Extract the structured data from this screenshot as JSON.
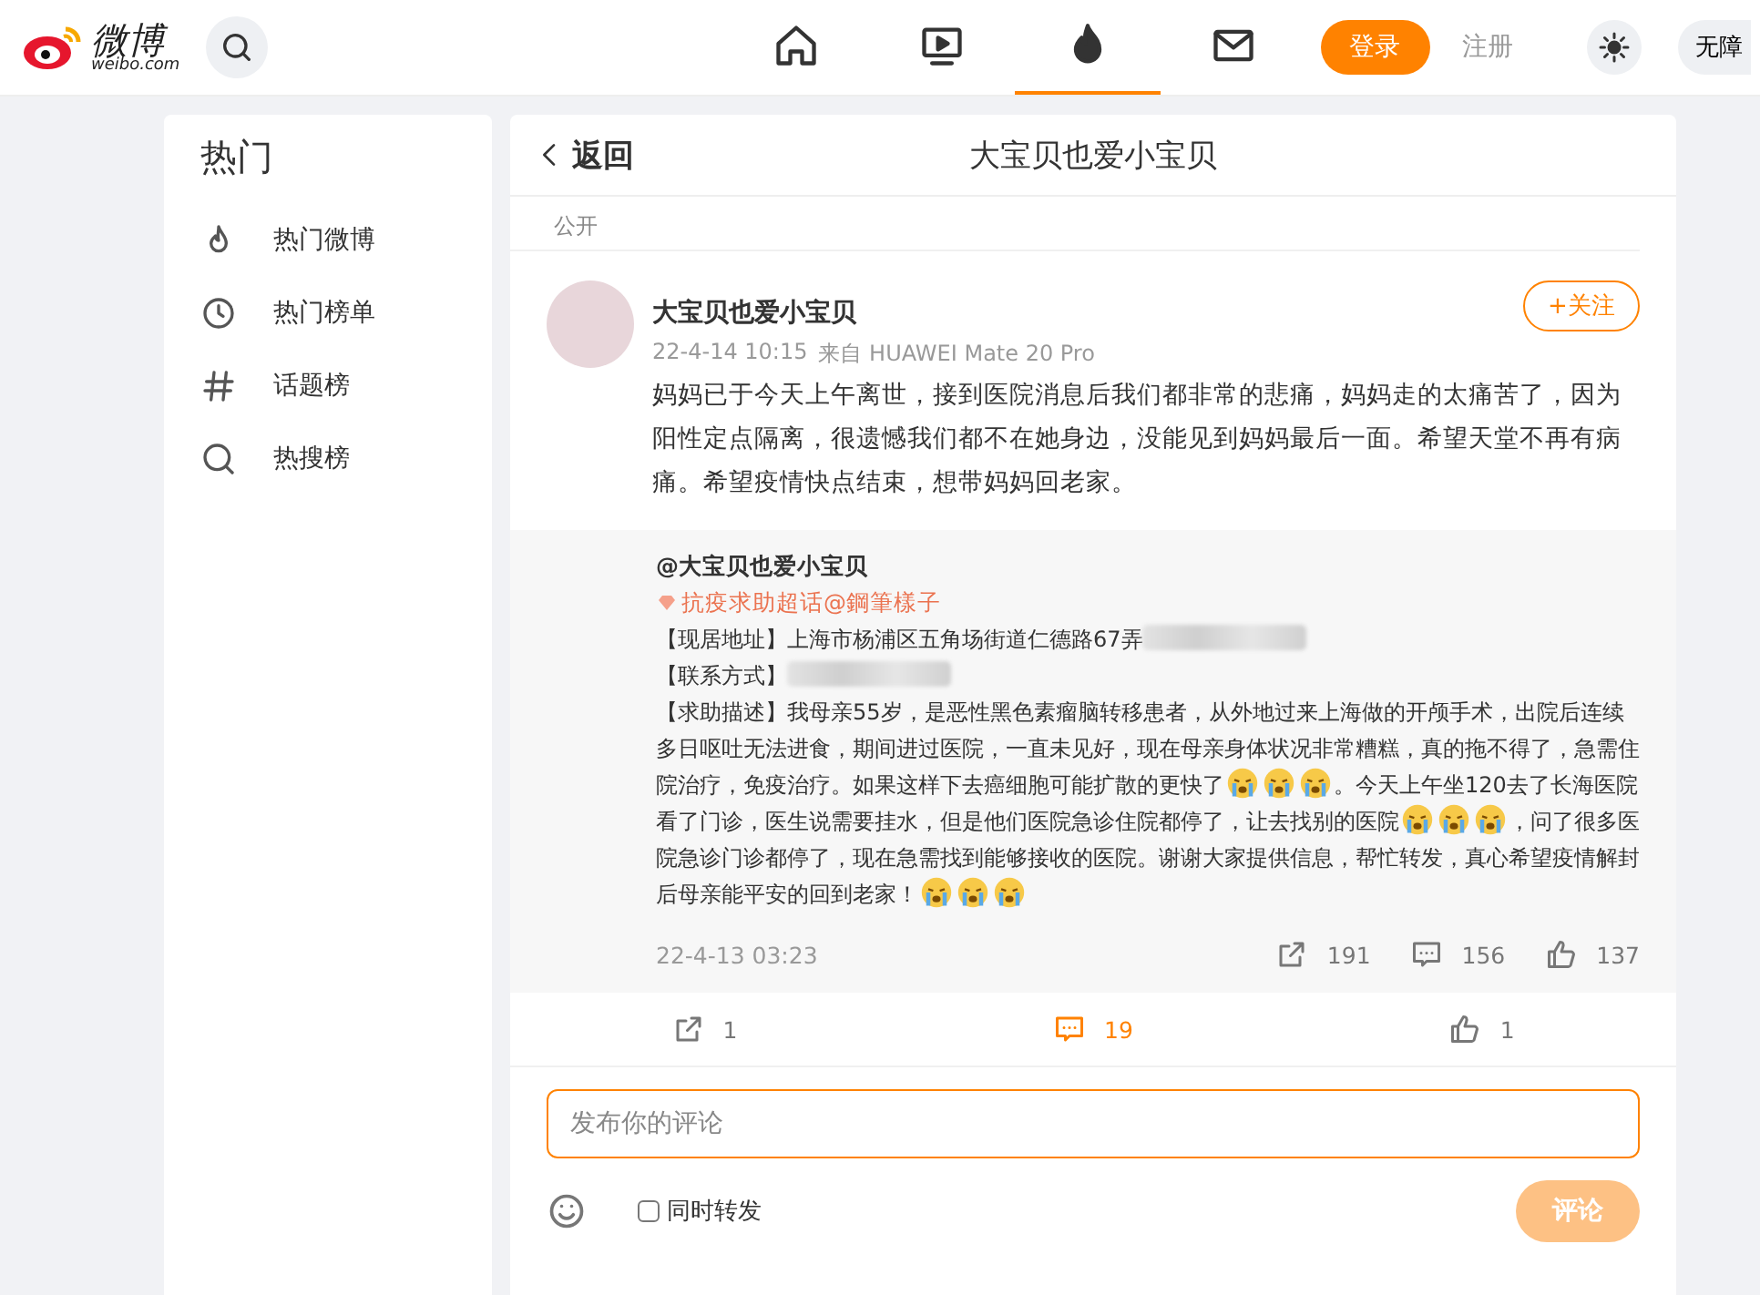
{
  "topbar": {
    "logo": {
      "title": "微博",
      "subtitle": "weibo.com"
    },
    "nav": [
      {
        "kind": "home",
        "selected": false
      },
      {
        "kind": "video",
        "selected": false
      },
      {
        "kind": "hot",
        "selected": true
      },
      {
        "kind": "mail",
        "selected": false
      }
    ],
    "login": "登录",
    "register": "注册",
    "accessibility": "无障"
  },
  "sidebar": {
    "title": "热门",
    "items": [
      {
        "kind": "fire",
        "label": "热门微博"
      },
      {
        "kind": "clock",
        "label": "热门榜单"
      },
      {
        "kind": "hash",
        "label": "话题榜"
      },
      {
        "kind": "search",
        "label": "热搜榜"
      }
    ]
  },
  "post": {
    "back": "返回",
    "title": "大宝贝也爱小宝贝",
    "visibility": "公开",
    "author": "大宝贝也爱小宝贝",
    "time": "22-4-14 10:15",
    "source": "来自 HUAWEI Mate 20 Pro",
    "follow": "+关注",
    "text": "妈妈已于今天上午离世，接到医院消息后我们都非常的悲痛，妈妈走的太痛苦了，因为阳性定点隔离，很遗憾我们都不在她身边，没能见到妈妈最后一面。希望天堂不再有病痛。希望疫情快点结束，想带妈妈回老家。",
    "repost": {
      "author": "@大宝贝也爱小宝贝",
      "topic": "抗疫求助超话@鋼筆樣子",
      "paragraphs": [
        [
          {
            "kind": "text",
            "text": "【现居地址】上海市杨浦区五角场街道仁德路67弄"
          },
          {
            "kind": "blur"
          }
        ],
        [
          {
            "kind": "text",
            "text": "【联系方式】"
          },
          {
            "kind": "blur"
          }
        ],
        [
          {
            "kind": "text",
            "text": "【求助描述】我母亲55岁，是恶性黑色素瘤脑转移患者，从外地过来上海做的开颅手术，出院后连续"
          }
        ],
        [
          {
            "kind": "text",
            "text": "多日呕吐无法进食，期间进过医院，一直未见好，现在母亲身体状况非常糟糕，真的拖不得了，急需住"
          }
        ],
        [
          {
            "kind": "text",
            "text": "院治疗，免疫治疗。如果这样下去癌细胞可能扩散的更快了"
          },
          {
            "kind": "emoji"
          },
          {
            "kind": "emoji"
          },
          {
            "kind": "emoji"
          },
          {
            "kind": "text",
            "text": "。今天上午坐120去了长海医院"
          }
        ],
        [
          {
            "kind": "text",
            "text": "看了门诊，医生说需要挂水，但是他们医院急诊住院都停了，让去找别的医院"
          },
          {
            "kind": "emoji"
          },
          {
            "kind": "emoji"
          },
          {
            "kind": "emoji"
          },
          {
            "kind": "text",
            "text": "，问了很多医"
          }
        ],
        [
          {
            "kind": "text",
            "text": "院急诊门诊都停了，现在急需找到能够接收的医院。谢谢大家提供信息，帮忙转发，真心希望疫情解封"
          }
        ],
        [
          {
            "kind": "text",
            "text": "后母亲能平安的回到老家！"
          },
          {
            "kind": "emoji"
          },
          {
            "kind": "emoji"
          },
          {
            "kind": "emoji"
          }
        ]
      ],
      "time": "22-4-13 03:23",
      "reposts": "191",
      "comments": "156",
      "likes": "137"
    },
    "actions": [
      {
        "kind": "repost",
        "count": "1",
        "selected": false
      },
      {
        "kind": "comment",
        "count": "19",
        "selected": true
      },
      {
        "kind": "like",
        "count": "1",
        "selected": false
      }
    ],
    "comment_box": {
      "placeholder": "发布你的评论",
      "also_repost": {
        "label": "同时转发",
        "checked": false
      },
      "submit": {
        "label": "评论",
        "disabled": true
      }
    }
  }
}
